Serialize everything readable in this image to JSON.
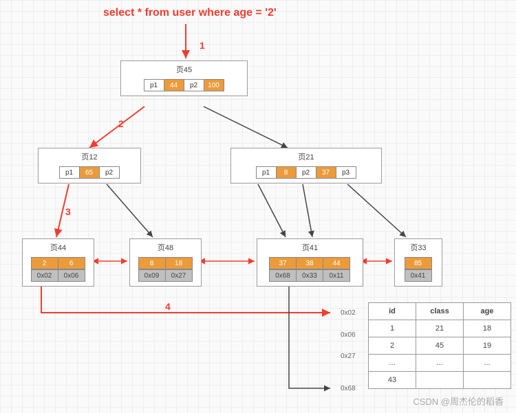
{
  "sql": "select * from user where age = '2'",
  "steps": {
    "s1": "1",
    "s2": "2",
    "s3": "3",
    "s4": "4"
  },
  "nodes": {
    "n45": {
      "title": "页45",
      "cells": [
        "p1",
        "44",
        "p2",
        "100"
      ]
    },
    "n12": {
      "title": "页12",
      "cells": [
        "p1",
        "65",
        "p2"
      ]
    },
    "n21": {
      "title": "页21",
      "cells": [
        "p1",
        "8",
        "p2",
        "37",
        "p3"
      ]
    },
    "n44": {
      "title": "页44",
      "top": [
        "2",
        "6"
      ],
      "bot": [
        "0x02",
        "0x06"
      ]
    },
    "n48": {
      "title": "页48",
      "top": [
        "8",
        "18"
      ],
      "bot": [
        "0x09",
        "0x27"
      ]
    },
    "n41": {
      "title": "页41",
      "top": [
        "37",
        "38",
        "44"
      ],
      "bot": [
        "0x68",
        "0x33",
        "0x11"
      ]
    },
    "n33": {
      "title": "页33",
      "top": [
        "85"
      ],
      "bot": [
        "0x41"
      ]
    }
  },
  "addrs": {
    "a1": "0x02",
    "a2": "0x06",
    "a3": "0x27",
    "a4": "0x68"
  },
  "table": {
    "header": [
      "id",
      "class",
      "age"
    ],
    "rows": [
      [
        "1",
        "21",
        "18"
      ],
      [
        "2",
        "45",
        "19"
      ],
      [
        "...",
        "...",
        "..."
      ],
      [
        "43",
        "",
        ""
      ]
    ]
  },
  "watermark": "CSDN @周杰伦的稻香"
}
